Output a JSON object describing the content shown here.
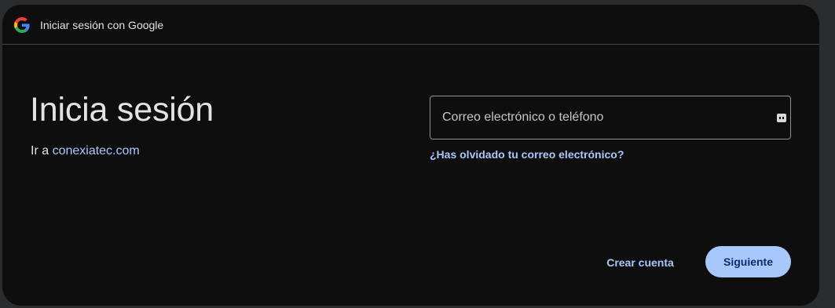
{
  "titlebar": {
    "logo_icon": "google-g-icon",
    "title": "Iniciar sesión con Google"
  },
  "main": {
    "heading": "Inicia sesión",
    "goto_prefix": "Ir a ",
    "goto_link": "conexiatec.com"
  },
  "form": {
    "email_placeholder": "Correo electrónico o teléfono",
    "email_value": "",
    "field_icon": "autofill-key-icon",
    "forgot_email": "¿Has olvidado tu correo electrónico?"
  },
  "actions": {
    "create_account": "Crear cuenta",
    "next": "Siguiente"
  },
  "colors": {
    "background": "#0e0e0f",
    "accent": "#a8c7fa",
    "text": "#e3e3e3"
  }
}
